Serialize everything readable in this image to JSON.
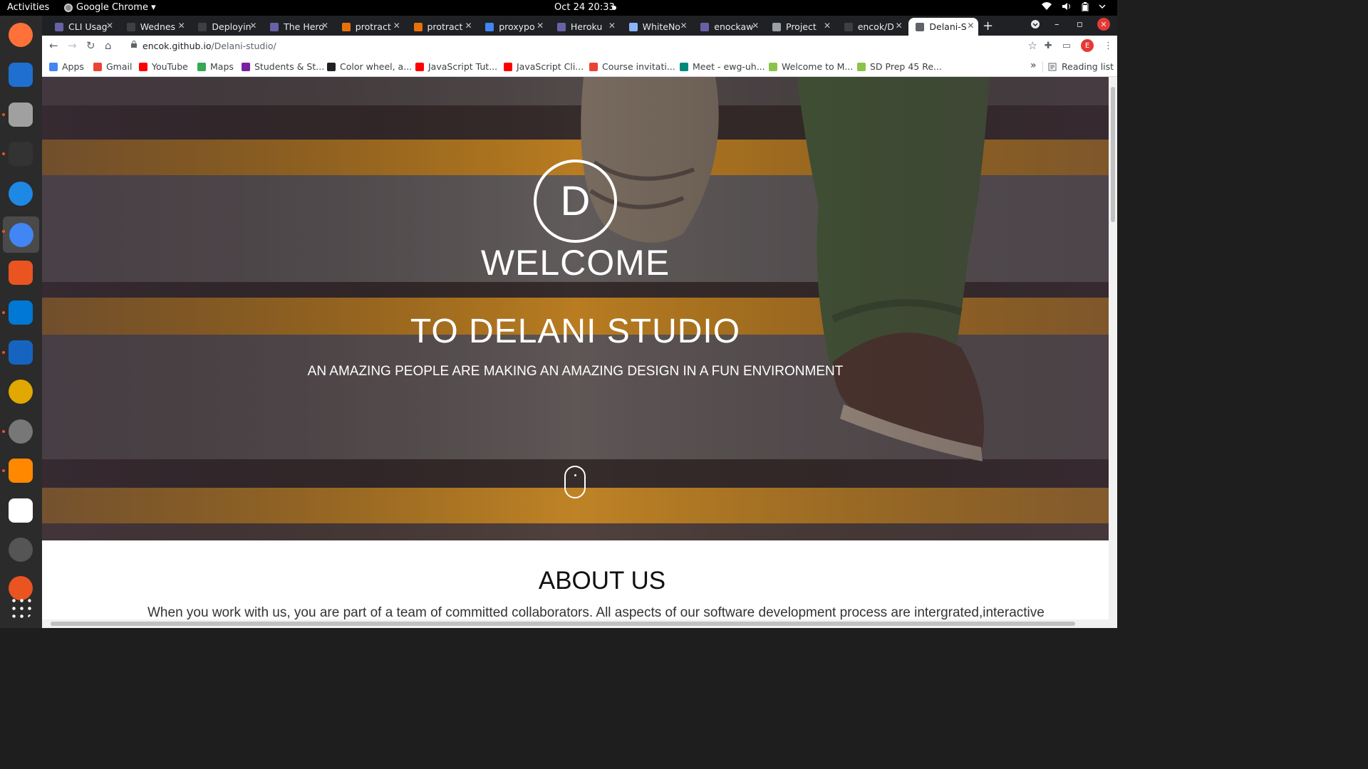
{
  "system": {
    "activities": "Activities",
    "app_name": "Google Chrome ▾",
    "clock": "Oct 24  20:33"
  },
  "tabs": [
    {
      "label": "CLI Usag",
      "icon": "heroku-icon",
      "color": "#6762a6"
    },
    {
      "label": "Wednes",
      "icon": "leaf-icon",
      "color": "#3c4043"
    },
    {
      "label": "Deployin",
      "icon": "github-icon",
      "color": "#3c4043"
    },
    {
      "label": "The Hero",
      "icon": "heroku-icon",
      "color": "#6762a6"
    },
    {
      "label": "protract",
      "icon": "flame-icon",
      "color": "#e8710a"
    },
    {
      "label": "protract",
      "icon": "flame-icon",
      "color": "#e8710a"
    },
    {
      "label": "proxypo",
      "icon": "google-icon",
      "color": "#4285f4"
    },
    {
      "label": "Heroku",
      "icon": "heroku-icon",
      "color": "#6762a6"
    },
    {
      "label": "WhiteNo",
      "icon": "doc-icon",
      "color": "#8ab4f8"
    },
    {
      "label": "enockaw",
      "icon": "heroku-icon",
      "color": "#6762a6"
    },
    {
      "label": "Project",
      "icon": "globe-icon",
      "color": "#9aa0a6"
    },
    {
      "label": "encok/D",
      "icon": "github-icon",
      "color": "#3c4043"
    },
    {
      "label": "Delani-S",
      "icon": "globe-icon",
      "color": "#5f6368",
      "active": true
    }
  ],
  "omnibox": {
    "domain": "encok.github.io",
    "path": "/Delani-studio/"
  },
  "bookmarks": [
    {
      "label": "Apps",
      "icon": "apps-grid-icon",
      "color": "#4285f4"
    },
    {
      "label": "Gmail",
      "icon": "gmail-icon",
      "color": "#ea4335"
    },
    {
      "label": "YouTube",
      "icon": "youtube-icon",
      "color": "#ff0000"
    },
    {
      "label": "Maps",
      "icon": "maps-pin-icon",
      "color": "#34a853"
    },
    {
      "label": "Students & St...",
      "icon": "classroom-icon",
      "color": "#7b1fa2"
    },
    {
      "label": "Color wheel, a...",
      "icon": "adobe-color-icon",
      "color": "#202124"
    },
    {
      "label": "JavaScript Tut...",
      "icon": "youtube-icon",
      "color": "#ff0000"
    },
    {
      "label": "JavaScript Cli...",
      "icon": "youtube-icon",
      "color": "#ff0000"
    },
    {
      "label": "Course invitati...",
      "icon": "gmail-icon",
      "color": "#ea4335"
    },
    {
      "label": "Meet - ewg-uh...",
      "icon": "meet-icon",
      "color": "#00897b"
    },
    {
      "label": "Welcome to M...",
      "icon": "moringa-icon",
      "color": "#8bc34a"
    },
    {
      "label": "SD Prep 45 Re...",
      "icon": "moringa-icon",
      "color": "#8bc34a"
    }
  ],
  "reading_list": "Reading list",
  "profile_initial": "E",
  "hero": {
    "logo_letter": "D",
    "title": "WELCOME",
    "subtitle": "TO DELANI STUDIO",
    "tagline": "AN AMAZING PEOPLE ARE MAKING AN AMAZING DESIGN IN A FUN ENVIRONMENT"
  },
  "about": {
    "title": "ABOUT US",
    "text": "When you work with us, you are part of a team of committed collaborators. All aspects of our software development process are intergrated,interactive"
  },
  "dock": [
    {
      "name": "firefox-icon",
      "color": "#ff7139"
    },
    {
      "name": "thunderbird-icon",
      "color": "#1f6fd1"
    },
    {
      "name": "files-icon",
      "color": "#a0a0a0"
    },
    {
      "name": "terminal-icon",
      "color": "#333333"
    },
    {
      "name": "help-icon",
      "color": "#1e88e5"
    },
    {
      "name": "chrome-icon",
      "color": "#4285f4"
    },
    {
      "name": "software-center-icon",
      "color": "#e95420"
    },
    {
      "name": "vscode-icon",
      "color": "#0078d4"
    },
    {
      "name": "writer-icon",
      "color": "#1565c0"
    },
    {
      "name": "rhythmbox-icon",
      "color": "#e0a800"
    },
    {
      "name": "settings-icon",
      "color": "#777777"
    },
    {
      "name": "vlc-icon",
      "color": "#ff8800"
    },
    {
      "name": "slack-icon",
      "color": "#ffffff"
    },
    {
      "name": "updater-icon",
      "color": "#555555"
    },
    {
      "name": "ubuntu-icon",
      "color": "#e95420"
    },
    {
      "name": "show-apps-icon",
      "color": "#ffffff"
    }
  ]
}
